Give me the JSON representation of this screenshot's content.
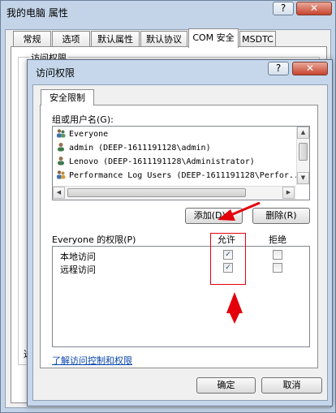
{
  "back_window": {
    "title": "我的电脑 属性",
    "help_glyph": "?",
    "close_glyph": "✕",
    "tabs": [
      {
        "label": "常规"
      },
      {
        "label": "选项"
      },
      {
        "label": "默认属性"
      },
      {
        "label": "默认协议"
      },
      {
        "label": "COM 安全"
      },
      {
        "label": "MSDTC"
      }
    ],
    "group_title": "访问权限",
    "peek_text": "选"
  },
  "dialog": {
    "title": "访问权限",
    "help_glyph": "?",
    "close_glyph": "✕",
    "tab_label": "安全限制",
    "users_label": "组或用户名(G):",
    "users": [
      {
        "name": "Everyone",
        "icon": "group-icon"
      },
      {
        "name": "admin (DEEP-1611191128\\admin)",
        "icon": "user-icon"
      },
      {
        "name": "Lenovo (DEEP-1611191128\\Administrator)",
        "icon": "user-icon"
      },
      {
        "name": "Performance Log Users (DEEP-1611191128\\Perfor...",
        "icon": "group-icon"
      }
    ],
    "add_button": "添加(D)...",
    "remove_button": "删除(R)",
    "permissions_label": "Everyone 的权限(P)",
    "allow_header": "允许",
    "deny_header": "拒绝",
    "permissions": [
      {
        "name": "本地访问",
        "allow": true,
        "deny": false
      },
      {
        "name": "远程访问",
        "allow": true,
        "deny": false
      }
    ],
    "learn_link": "了解访问控制和权限",
    "ok_button": "确定",
    "cancel_button": "取消"
  },
  "colors": {
    "annotation": "#e3000b",
    "link": "#0645ad",
    "title_bar": "#c6d7eb"
  }
}
